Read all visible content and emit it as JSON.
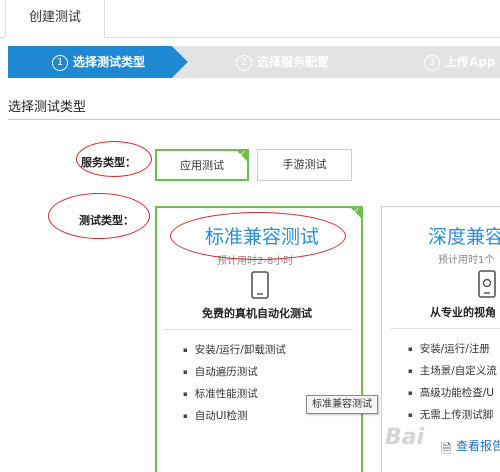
{
  "tab": {
    "label": "创建测试"
  },
  "steps": [
    {
      "num": "1",
      "label": "选择测试类型"
    },
    {
      "num": "2",
      "label": "选择服务配置"
    },
    {
      "num": "3",
      "label": "上传App"
    }
  ],
  "section_title": "选择测试类型",
  "service_type": {
    "label": "服务类型：",
    "options": [
      "应用测试",
      "手游测试"
    ],
    "selected": "应用测试"
  },
  "test_type": {
    "label": "测试类型："
  },
  "cards": [
    {
      "title": "标准兼容测试",
      "subtitle": "预计用时2-8小时",
      "tagline": "免费的真机自动化测试",
      "features": [
        "安装/运行/卸载测试",
        "自动遍历测试",
        "标准性能测试",
        "自动UI检测"
      ]
    },
    {
      "title": "深度兼容",
      "subtitle": "预计用时1个",
      "tagline": "从专业的视角",
      "features": [
        "安装/运行/注册",
        "主场景/自定义流",
        "高级功能检查/U",
        "无需上传测试脚"
      ],
      "link": "查看报告"
    }
  ],
  "tooltip": "标准兼容测试",
  "colors": {
    "step_active": "#1e88d2",
    "step_inactive": "#e3e3e3",
    "selected_green": "#6fbf4f",
    "title_blue": "#2a8fd8",
    "annotation_red": "#d9232e"
  }
}
